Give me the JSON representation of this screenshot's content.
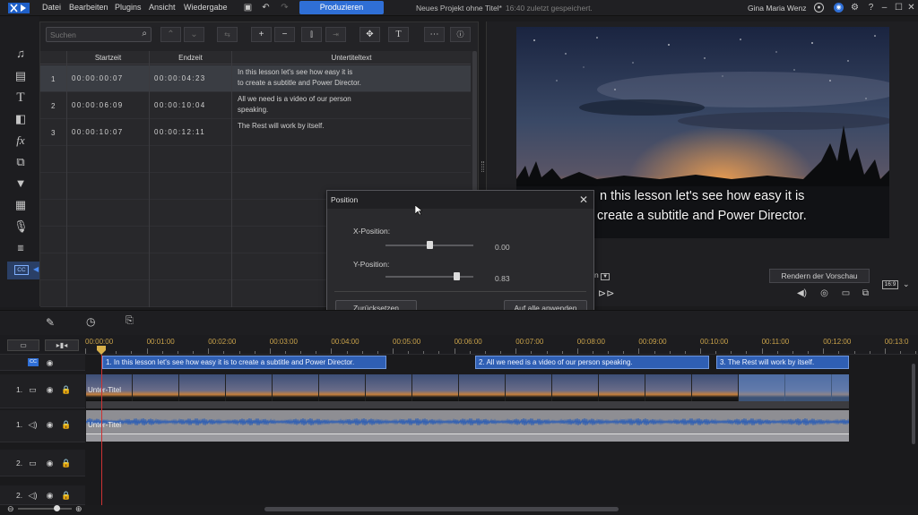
{
  "menubar": {
    "items": [
      "Datei",
      "Bearbeiten",
      "Plugins",
      "Ansicht",
      "Wiedergabe"
    ],
    "produce_label": "Produzieren",
    "project_title": "Neues Projekt ohne Titel*",
    "saved_note": "16:40 zuletzt gespeichert.",
    "user_name": "Gina Maria Wenz"
  },
  "subtitle_panel": {
    "search_placeholder": "Suchen",
    "columns": [
      "Startzeit",
      "Endzeit",
      "Untertiteltext"
    ],
    "rows": [
      {
        "index": "1",
        "start": "00:00:00:07",
        "end": "00:00:04:23",
        "text_line1": "In this lesson let's see how easy it is",
        "text_line2": "to create a subtitle and Power Director."
      },
      {
        "index": "2",
        "start": "00:00:06:09",
        "end": "00:00:10:04",
        "text_line1": "All we need is a video of our person",
        "text_line2": "speaking."
      },
      {
        "index": "3",
        "start": "00:00:10:07",
        "end": "00:00:12:11",
        "text_line1": "The Rest will work by itself.",
        "text_line2": ""
      }
    ],
    "selected_row": 1
  },
  "preview": {
    "subtitle_line1": "n this lesson let's see how easy it is",
    "subtitle_line2": "create a subtitle and Power Director.",
    "render_label": "Rendern der Vorschau",
    "ratio_label": "16:9",
    "dropdown_label": "n"
  },
  "position_dialog": {
    "title": "Position",
    "x_label": "X-Position:",
    "x_value": "0.00",
    "x_slider_fraction": 0.5,
    "y_label": "Y-Position:",
    "y_value": "0.83",
    "y_slider_fraction": 0.83,
    "reset_label": "Zurücksetzen",
    "apply_all_label": "Auf alle anwenden"
  },
  "timeline": {
    "ticks": [
      "00:00:00",
      "00:01:00",
      "00:02:00",
      "00:03:00",
      "00:04:00",
      "00:05:00",
      "00:06:00",
      "00:07:00",
      "00:08:00",
      "00:09:00",
      "00:10:00",
      "00:11:00",
      "00:12:00",
      "00:13:0"
    ],
    "subtitle_clips": [
      "1. In this lesson let's see how easy it is  to create a subtitle and Power Director.",
      "2. All we need is a video of our person  speaking.",
      "3. The Rest will work by itself."
    ],
    "tracks": [
      {
        "label": "1.",
        "kind": "video"
      },
      {
        "label": "1.",
        "kind": "audio"
      },
      {
        "label": "2.",
        "kind": "video"
      },
      {
        "label": "2.",
        "kind": "audio"
      }
    ],
    "video_clip_label": "Unter-Titel",
    "audio_clip_label": "Unter-Titel"
  },
  "colors": {
    "accent": "#2f6fd6",
    "subtitle_clip": "#2f5fb4",
    "timecode": "#c9a24a"
  }
}
